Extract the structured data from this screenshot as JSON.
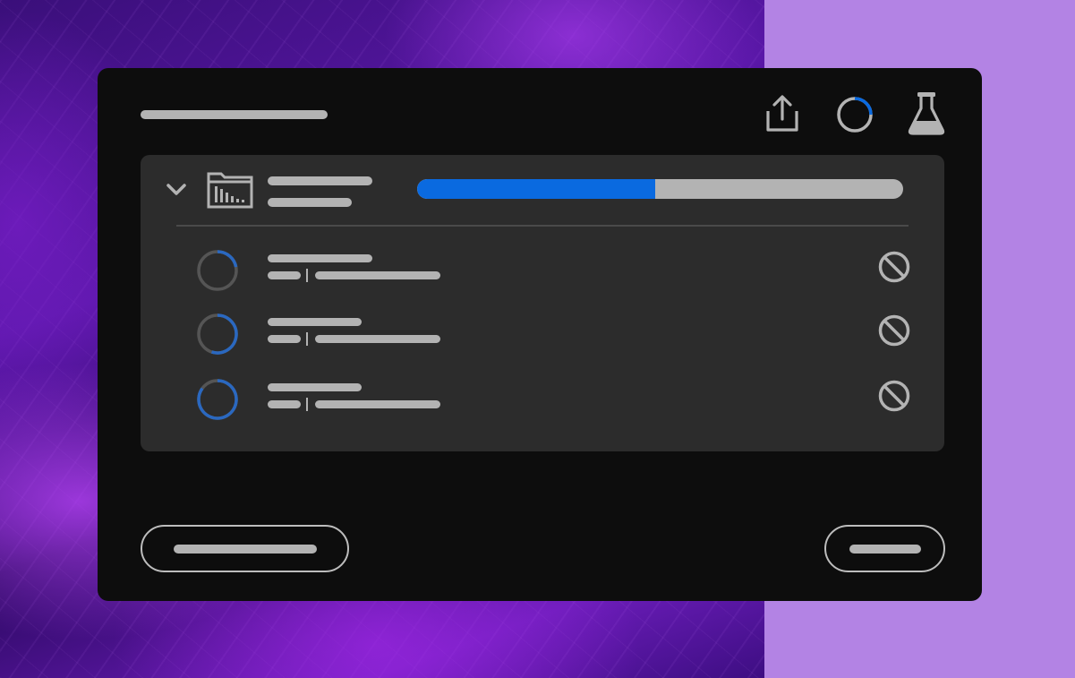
{
  "colors": {
    "accent": "#0a6ae0",
    "bar_gray": "#b3b3b3",
    "panel_bg": "#0d0d0d",
    "group_bg": "#2c2c2c",
    "right_bg": "#b383e4"
  },
  "header": {
    "icons": [
      "share-icon",
      "sync-progress-icon",
      "flask-icon"
    ]
  },
  "upload_group": {
    "expanded": true,
    "icons": [
      "chevron-down-icon",
      "folder-chart-icon"
    ],
    "progress": 0.49,
    "items": [
      {
        "progress": 0.22,
        "icon": "cancel-icon"
      },
      {
        "progress": 0.55,
        "icon": "cancel-icon"
      },
      {
        "progress": 0.85,
        "icon": "cancel-icon"
      }
    ]
  },
  "footer": {
    "buttons": [
      "primary-action-button",
      "secondary-action-button"
    ]
  }
}
